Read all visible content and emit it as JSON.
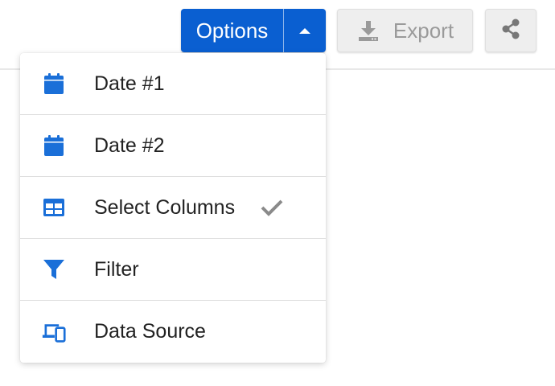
{
  "toolbar": {
    "options_label": "Options",
    "export_label": "Export"
  },
  "menu": {
    "items": [
      {
        "label": "Date #1",
        "icon": "calendar-icon",
        "checked": false
      },
      {
        "label": "Date #2",
        "icon": "calendar-icon",
        "checked": false
      },
      {
        "label": "Select Columns",
        "icon": "table-columns-icon",
        "checked": true
      },
      {
        "label": "Filter",
        "icon": "filter-icon",
        "checked": false
      },
      {
        "label": "Data Source",
        "icon": "devices-icon",
        "checked": false
      }
    ]
  },
  "colors": {
    "primary": "#0a5fd1",
    "icon_blue": "#1a6fd8",
    "check_gray": "#8a8a8a",
    "button_gray": "#eeeeee"
  }
}
